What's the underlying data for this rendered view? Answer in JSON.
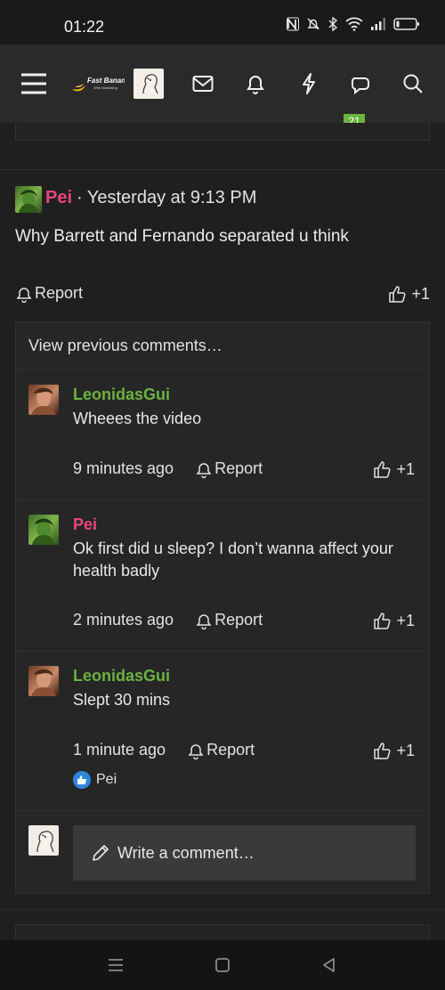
{
  "status_bar": {
    "time": "01:22",
    "icons": [
      "nfc-icon",
      "mute-icon",
      "bluetooth-icon",
      "wifi-icon",
      "signal-icon",
      "battery-icon"
    ]
  },
  "navbar": {
    "logo_text": "Fast Banana",
    "logo_subtext": "Web Marketing",
    "alerts_badge": "21",
    "icons": [
      "menu-icon",
      "logo",
      "avatar",
      "mail-icon",
      "bell-icon",
      "lightning-icon",
      "chat-icon",
      "search-icon"
    ]
  },
  "post": {
    "author": "Pei",
    "separator": "·",
    "time": "Yesterday at 9:13 PM",
    "body": "Why Barrett and Fernando separated u think",
    "report_label": "Report",
    "like_label": "+1"
  },
  "comments": {
    "view_previous": "View previous comments…",
    "items": [
      {
        "author": "LeonidasGui",
        "text": "Wheees the video",
        "time": "9 minutes ago",
        "report_label": "Report",
        "like_label": "+1"
      },
      {
        "author": "Pei",
        "text": "Ok first did u sleep? I don’t wanna affect your health badly",
        "time": "2 minutes ago",
        "report_label": "Report",
        "like_label": "+1"
      },
      {
        "author": "LeonidasGui",
        "text": "Slept 30 mins",
        "time": "1 minute ago",
        "report_label": "Report",
        "like_label": "+1",
        "reactor": "Pei"
      }
    ],
    "write_placeholder": "Write a comment…"
  },
  "colors": {
    "author_pink": "#e94679",
    "author_green": "#6cb33f",
    "background": "#1f1f1f",
    "like_badge_blue": "#2f86de"
  }
}
